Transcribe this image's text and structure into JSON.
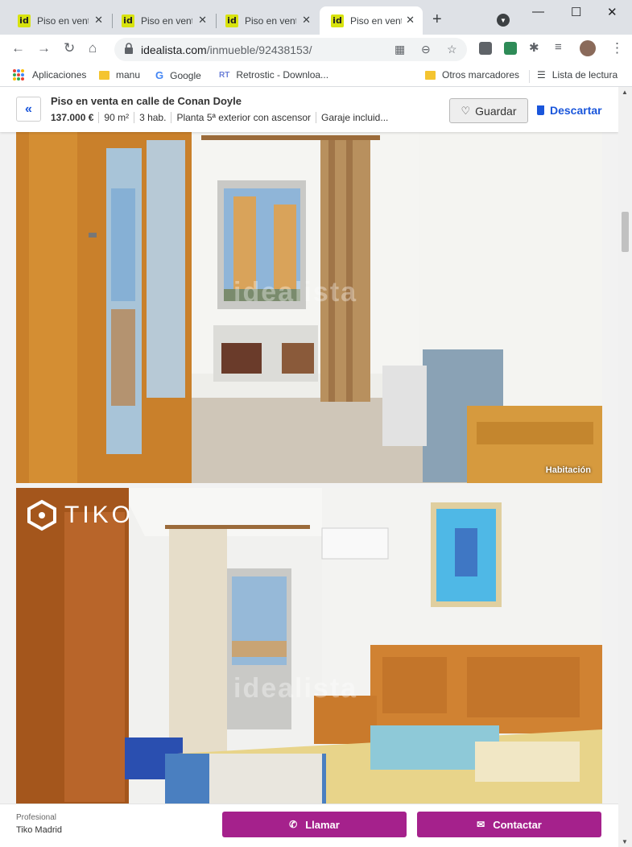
{
  "browser": {
    "tabs": [
      {
        "title": "Piso en venta",
        "favicon": "id",
        "active": false
      },
      {
        "title": "Piso en venta",
        "favicon": "id",
        "active": false
      },
      {
        "title": "Piso en venta",
        "favicon": "id",
        "active": false
      },
      {
        "title": "Piso en venta",
        "favicon": "id",
        "active": true
      }
    ],
    "new_tab_icon": "+",
    "url_domain": "idealista.com",
    "url_path": "/inmueble/92438153/",
    "bookmarks": [
      {
        "label": "Aplicaciones",
        "icon": "apps-grid-icon"
      },
      {
        "label": "manu",
        "icon": "folder-icon"
      },
      {
        "label": "Google",
        "icon": "google-icon"
      },
      {
        "label": "Retrostic - Downloa...",
        "icon": "retrostic-icon"
      },
      {
        "label": "Otros marcadores",
        "icon": "folder-icon"
      },
      {
        "label": "Lista de lectura",
        "icon": "reading-list-icon"
      }
    ]
  },
  "listing": {
    "title": "Piso en venta en calle de Conan Doyle",
    "price": "137.000 €",
    "size": "90 m²",
    "rooms": "3 hab.",
    "floor": "Planta 5ª exterior con ascensor",
    "garage": "Garaje incluid...",
    "save_label": "Guardar",
    "discard_label": "Descartar"
  },
  "photos": [
    {
      "caption": "Habitación",
      "watermark": "idealista"
    },
    {
      "caption": "",
      "watermark": "idealista",
      "logo_text": "TIKO"
    }
  ],
  "contact": {
    "agency_type": "Profesional",
    "agency_name": "Tiko Madrid",
    "call_label": "Llamar",
    "contact_label": "Contactar"
  },
  "colors": {
    "accent": "#a5218c",
    "link": "#1a56db",
    "favicon": "#d8e30f"
  }
}
